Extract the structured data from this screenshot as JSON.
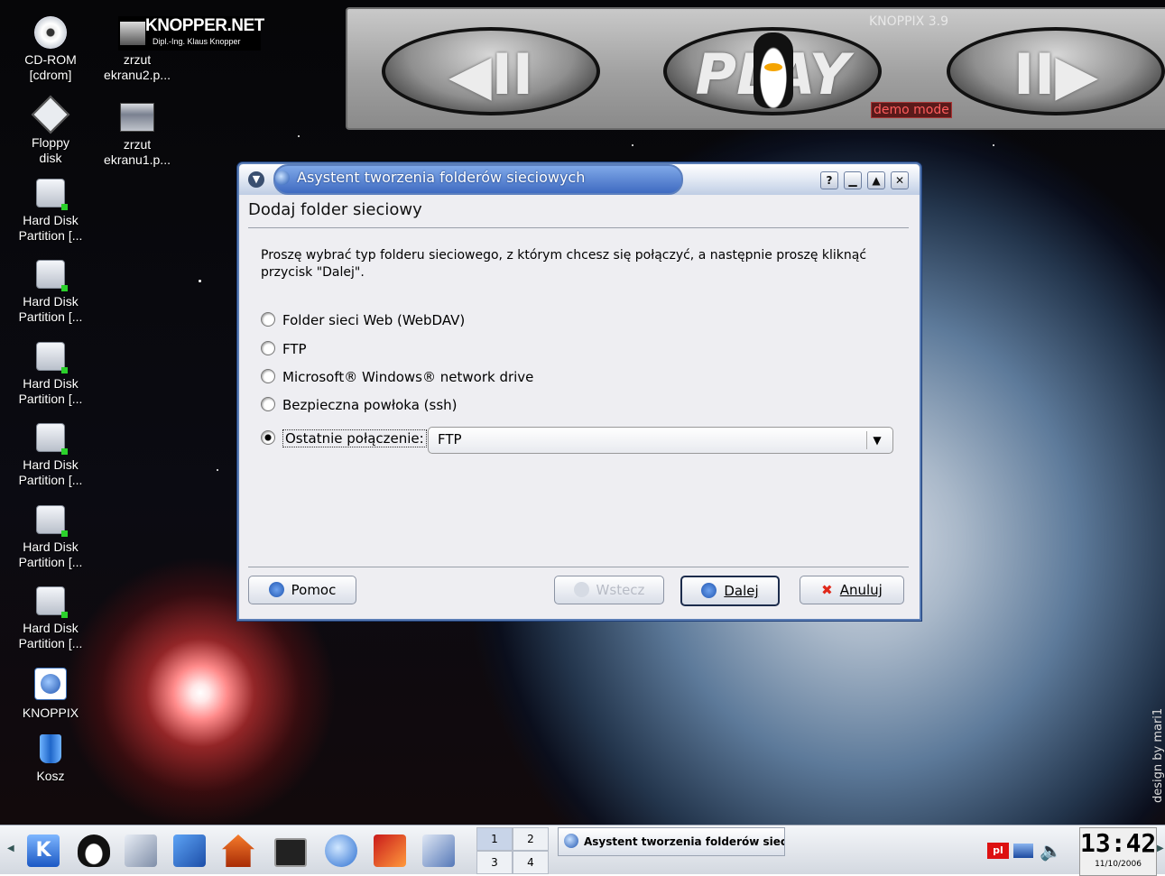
{
  "desktop": {
    "icons": [
      {
        "label": "CD-ROM\n[cdrom]",
        "icon": "cdrom-icon"
      },
      {
        "label": "zrzut\nekranu2.p...",
        "icon": "screenshot-file-icon"
      },
      {
        "label": "Floppy\ndisk",
        "icon": "floppy-icon"
      },
      {
        "label": "zrzut\nekranu1.p...",
        "icon": "screenshot-file-icon"
      },
      {
        "label": "Hard Disk\nPartition [...",
        "icon": "hard-disk-icon"
      },
      {
        "label": "Hard Disk\nPartition [...",
        "icon": "hard-disk-icon"
      },
      {
        "label": "Hard Disk\nPartition [...",
        "icon": "hard-disk-icon"
      },
      {
        "label": "Hard Disk\nPartition [...",
        "icon": "hard-disk-icon"
      },
      {
        "label": "Hard Disk\nPartition [...",
        "icon": "hard-disk-icon"
      },
      {
        "label": "Hard Disk\nPartition [...",
        "icon": "hard-disk-icon"
      },
      {
        "label": "KNOPPIX",
        "icon": "knoppix-icon"
      },
      {
        "label": "Kosz",
        "icon": "trash-icon"
      }
    ],
    "knopper_logo": {
      "line1": "KNOPPER.NET",
      "line2": "Dipl.-Ing. Klaus Knopper"
    },
    "top_panel": {
      "version": "KNOPPIX 3.9",
      "demo": "demo mode",
      "prev_label": "◀II",
      "play_label": "PLAY",
      "next_label": "II▶"
    },
    "design_credit": "design by mari1"
  },
  "dialog": {
    "title": "Asystent tworzenia folderów sieciowych",
    "heading": "Dodaj folder sieciowy",
    "description": "Proszę wybrać typ folderu sieciowego, z którym chcesz się połączyć, a następnie proszę kliknąć przycisk \"Dalej\".",
    "options": [
      {
        "label": "Folder sieci Web (WebDAV)",
        "checked": false
      },
      {
        "label": "FTP",
        "checked": false
      },
      {
        "label": "Microsoft® Windows® network drive",
        "checked": false
      },
      {
        "label": "Bezpieczna powłoka (ssh)",
        "checked": false
      }
    ],
    "recent": {
      "label": "Ostatnie połączenie:",
      "checked": true,
      "value": "FTP"
    },
    "buttons": {
      "help": "Pomoc",
      "back": "Wstecz",
      "next": "Dalej",
      "cancel": "Anuluj"
    }
  },
  "taskbar": {
    "pager": [
      "1",
      "2",
      "3",
      "4"
    ],
    "active_task": "Asystent tworzenia folderów sieci",
    "lang": "pl",
    "clock": {
      "time": "13:42",
      "date": "11/10/2006"
    }
  },
  "colors": {
    "accent": "#3f6bc1",
    "titlebar": "#bfcde4",
    "dialog_bg": "#eeeef2"
  }
}
